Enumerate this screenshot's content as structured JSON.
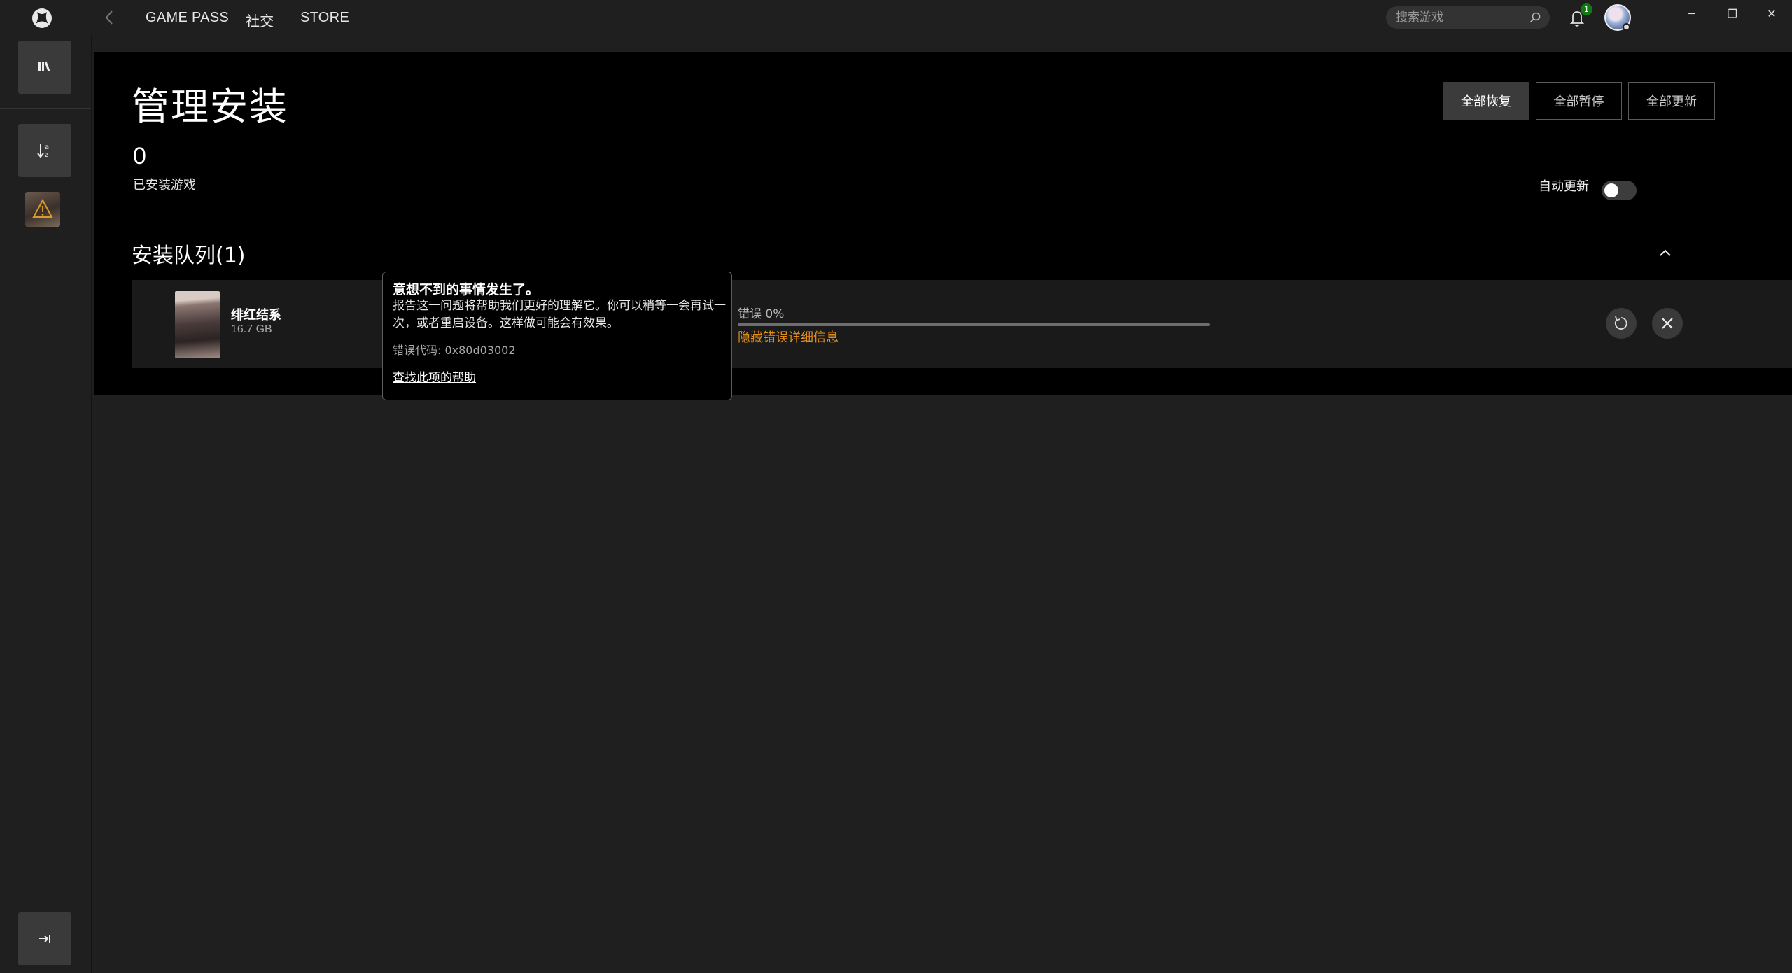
{
  "nav": {
    "gamepass": "GAME PASS",
    "social": "社交",
    "store": "STORE"
  },
  "search": {
    "placeholder": "搜索游戏"
  },
  "notifications": {
    "count": "1"
  },
  "window": {
    "minimize": "─",
    "restore": "❐",
    "close": "✕"
  },
  "page": {
    "title": "管理安装",
    "installed_count": "0",
    "installed_label": "已安装游戏",
    "buttons": {
      "resume_all": "全部恢复",
      "pause_all": "全部暂停",
      "update_all": "全部更新"
    },
    "auto_update_label": "自动更新",
    "auto_update_on": false
  },
  "queue": {
    "title": "安装队列(1)",
    "items": [
      {
        "name": "绯红结系",
        "size": "16.7 GB",
        "status": "错误 0%",
        "progress": 0,
        "hide_details": "隐藏错误详细信息"
      }
    ]
  },
  "error_popup": {
    "title": "意想不到的事情发生了。",
    "body": "报告这一问题将帮助我们更好的理解它。你可以稍等一会再试一次，或者重启设备。这样做可能会有效果。",
    "code": "错误代码: 0x80d03002",
    "help_link": "查找此项的帮助"
  },
  "colors": {
    "accent_green": "#107c10",
    "error_orange": "#e48e1a"
  }
}
